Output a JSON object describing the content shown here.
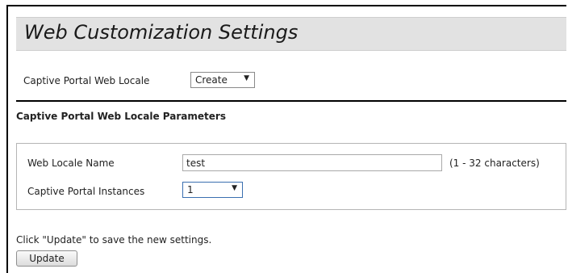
{
  "page": {
    "title": "Web Customization Settings"
  },
  "locale_selector": {
    "label": "Captive Portal Web Locale",
    "selected": "Create",
    "arrow": "▼"
  },
  "parameters": {
    "heading": "Captive Portal Web Locale Parameters",
    "web_locale_name": {
      "label": "Web Locale Name",
      "value": "test",
      "hint": "(1 - 32 characters)"
    },
    "instances": {
      "label": "Captive Portal Instances",
      "selected": "1",
      "arrow": "▼"
    }
  },
  "footer": {
    "instruction": "Click \"Update\" to save the new settings.",
    "update_label": "Update"
  }
}
